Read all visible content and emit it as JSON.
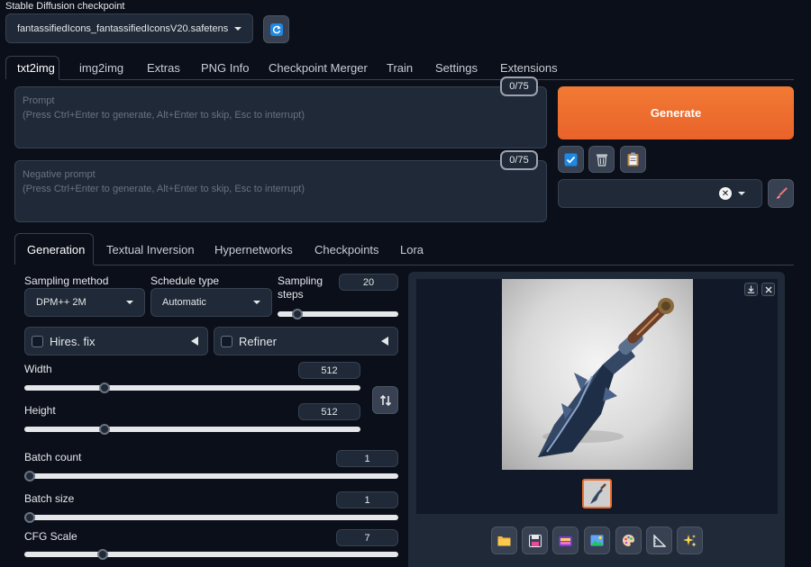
{
  "checkpoint": {
    "label": "Stable Diffusion checkpoint",
    "value": "fantassifiedIcons_fantassifiedIconsV20.safetens"
  },
  "main_tabs": [
    "txt2img",
    "img2img",
    "Extras",
    "PNG Info",
    "Checkpoint Merger",
    "Train",
    "Settings",
    "Extensions"
  ],
  "prompt": {
    "placeholder_title": "Prompt",
    "placeholder_hint": "(Press Ctrl+Enter to generate, Alt+Enter to skip, Esc to interrupt)",
    "counter": "0/75"
  },
  "negative_prompt": {
    "placeholder_title": "Negative prompt",
    "placeholder_hint": "(Press Ctrl+Enter to generate, Alt+Enter to skip, Esc to interrupt)",
    "counter": "0/75"
  },
  "generate_label": "Generate",
  "sub_tabs": [
    "Generation",
    "Textual Inversion",
    "Hypernetworks",
    "Checkpoints",
    "Lora"
  ],
  "sampling_method": {
    "label": "Sampling method",
    "value": "DPM++ 2M"
  },
  "schedule_type": {
    "label": "Schedule type",
    "value": "Automatic"
  },
  "sampling_steps": {
    "label": "Sampling steps",
    "value": "20",
    "fraction": 0.13
  },
  "hires_fix": {
    "label": "Hires. fix"
  },
  "refiner": {
    "label": "Refiner"
  },
  "width": {
    "label": "Width",
    "value": "512",
    "fraction": 0.23
  },
  "height": {
    "label": "Height",
    "value": "512",
    "fraction": 0.23
  },
  "batch_count": {
    "label": "Batch count",
    "value": "1",
    "fraction": 0.0
  },
  "batch_size": {
    "label": "Batch size",
    "value": "1",
    "fraction": 0.0
  },
  "cfg_scale": {
    "label": "CFG Scale",
    "value": "7",
    "fraction": 0.2
  },
  "icons": {
    "refresh": "refresh-icon",
    "style_apply": "check-icon",
    "trash": "trash-icon",
    "clipboard": "clipboard-icon",
    "brush": "brush-icon",
    "swap": "swap-icon",
    "download": "download-icon",
    "close": "close-icon",
    "output_buttons": [
      "folder-icon",
      "save-icon",
      "zip-icon",
      "image-icon",
      "palette-icon",
      "ruler-icon",
      "sparkle-icon"
    ]
  },
  "colors": {
    "accent": "#ee6e2b",
    "background": "#0b0f19",
    "panel": "#1f2937"
  }
}
